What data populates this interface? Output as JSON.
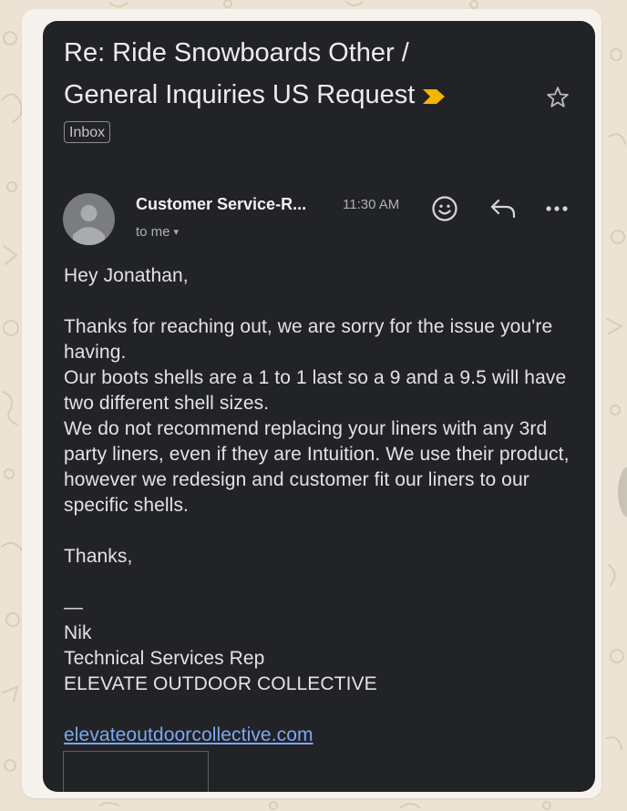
{
  "email": {
    "subject": "Re: Ride Snowboards Other / General Inquiries US Request",
    "label": "Inbox",
    "sender": "Customer Service-R...",
    "time": "11:30 AM",
    "recipient": "to me",
    "greeting": "Hey Jonathan,",
    "paragraphs": [
      "Thanks for reaching out, we are sorry for the issue you're having.",
      "Our boots shells are a 1 to 1 last so a 9 and a 9.5 will have two different shell sizes.",
      "We do not recommend replacing your liners with any 3rd party liners, even if they are Intuition. We use their product, however we redesign and customer fit our liners to our specific shells."
    ],
    "closing": "Thanks,",
    "signature": {
      "dash": "—",
      "name": "Nik",
      "title": "Technical Services Rep",
      "company": "ELEVATE OUTDOOR COLLECTIVE",
      "website": "elevateoutdoorcollective.com"
    }
  },
  "colors": {
    "card_background": "#222326",
    "importance_marker": "#f4b400",
    "link": "#7ca7f0",
    "chat_background": "#ece3d4"
  },
  "icons": {
    "importance": "importance-chevron-icon",
    "star": "star-outline-icon",
    "avatar": "person-icon",
    "reaction": "smiley-icon",
    "reply": "reply-arrow-icon",
    "more": "more-horizontal-icon",
    "recipient_expand": "chevron-down-icon"
  }
}
